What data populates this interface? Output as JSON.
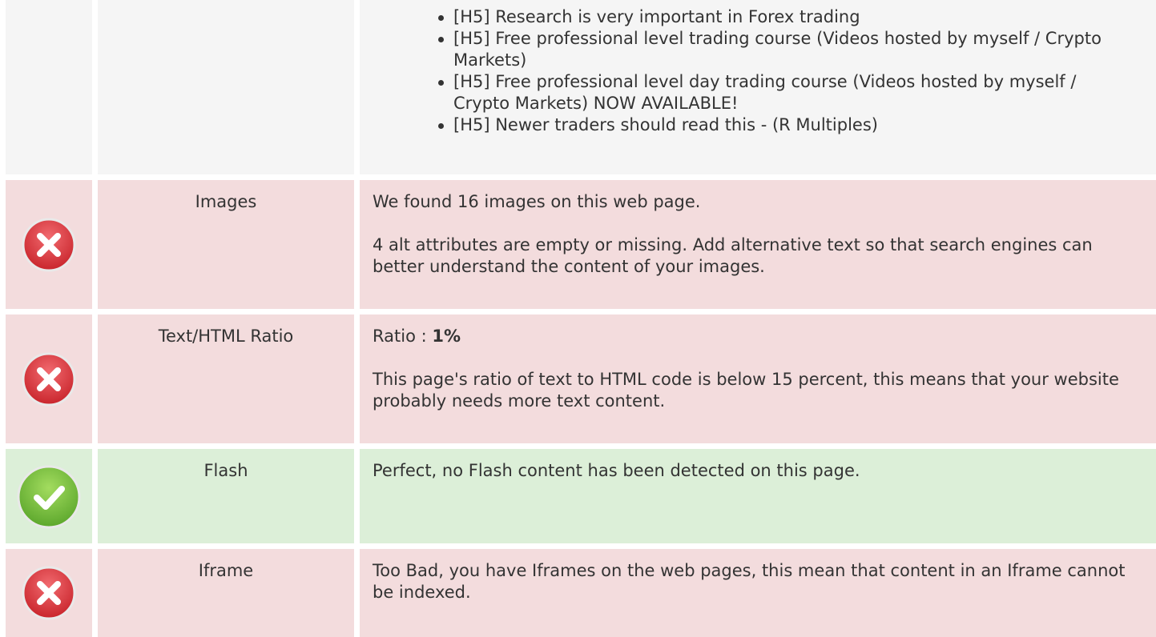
{
  "headings_list": [
    "[H5] Research is very important in Forex trading",
    "[H5] Free professional level trading course (Videos hosted by myself / Crypto Markets)",
    "[H5] Free professional level day trading course (Videos hosted by myself / Crypto Markets) NOW AVAILABLE!",
    "[H5] Newer traders should read this - (R Multiples)"
  ],
  "images": {
    "label": "Images",
    "status": "error",
    "line1": "We found 16 images on this web page.",
    "line2": "4 alt attributes are empty or missing. Add alternative text so that search engines can better understand the content of your images."
  },
  "ratio": {
    "label": "Text/HTML Ratio",
    "status": "error",
    "prefix": "Ratio : ",
    "value": "1%",
    "line2": "This page's ratio of text to HTML code is below 15 percent, this means that your website probably needs more text content."
  },
  "flash": {
    "label": "Flash",
    "status": "ok",
    "line1": "Perfect, no Flash content has been detected on this page."
  },
  "iframe": {
    "label": "Iframe",
    "status": "error",
    "line1": "Too Bad, you have Iframes on the web pages, this mean that content in an Iframe cannot be indexed."
  },
  "colors": {
    "error_bg": "#f3dcdd",
    "ok_bg": "#dcefd8",
    "neutral_bg": "#f5f5f5",
    "error_icon": "#d9363e",
    "ok_icon": "#74c043"
  }
}
